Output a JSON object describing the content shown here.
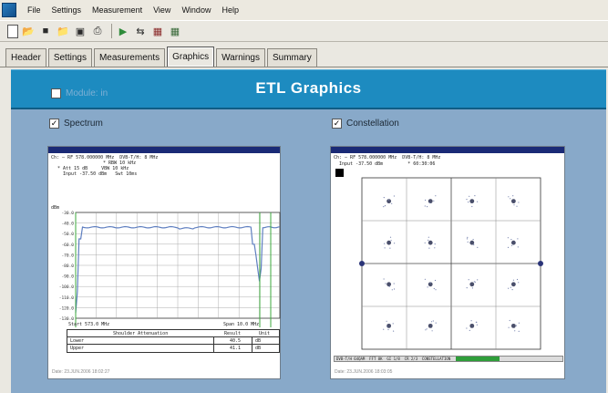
{
  "menu": {
    "items": [
      "File",
      "Settings",
      "Measurement",
      "View",
      "Window",
      "Help"
    ]
  },
  "toolbar": {
    "icons": [
      "new-icon",
      "open-icon",
      "save-icon",
      "open-folder-icon",
      "save-all-icon",
      "print-icon",
      "play-icon",
      "link-icon",
      "stop-icon",
      "grid-icon"
    ]
  },
  "tabs": [
    "Header",
    "Settings",
    "Measurements",
    "Graphics",
    "Warnings",
    "Summary"
  ],
  "active_tab": "Graphics",
  "banner": {
    "title": "ETL Graphics",
    "checkbox_label": "Module: in",
    "checkbox_checked": false
  },
  "spectrum": {
    "checkbox_label": "Spectrum",
    "checked": true,
    "header_line1": "Ch: — RF 578.000000 MHz  DVB-T/H: 8 MHz",
    "header_line2": "* RBW 10 kHz",
    "header_line3": "* Att 15 dB     VBW 10 kHz",
    "header_line4": "  Input -37.50 dBm   Swt 10ms",
    "ylabel": "dBm",
    "yticks": [
      "-30.0",
      "-40.0",
      "-50.0",
      "-60.0",
      "-70.0",
      "-80.0",
      "-90.0",
      "-100.0",
      "-110.0",
      "-120.0",
      "-130.0"
    ],
    "start_label": "Start 573.0 MHz",
    "stop_label": "Span 10.0 MHz",
    "table_header": "Shoulder Attenuation",
    "table_cols": [
      "Result",
      "Unit"
    ],
    "table_rows": [
      {
        "label": "Lower",
        "value": "40.5",
        "unit": "dB"
      },
      {
        "label": "Upper",
        "value": "41.1",
        "unit": "dB"
      }
    ],
    "footer": "Date: 23.JUN.2006  18:02:27"
  },
  "constellation": {
    "checkbox_label": "Constellation",
    "checked": true,
    "header_line1": "Ch: — RF 578.000000 MHz  DVB-T/H: 8 MHz",
    "header_line2": "  Input -37.50 dBm         * 60:30:06",
    "status_bar": "DVB-T/H 64QAM  FFT 8K  GI 1/8  CR 2/3  CONSTELLATION",
    "footer": "Date: 23.JUN.2006  18:03:05"
  },
  "colors": {
    "banner": "#1d8bc0",
    "content_bg": "#88a9c9",
    "trace": "#5f7fc0"
  }
}
